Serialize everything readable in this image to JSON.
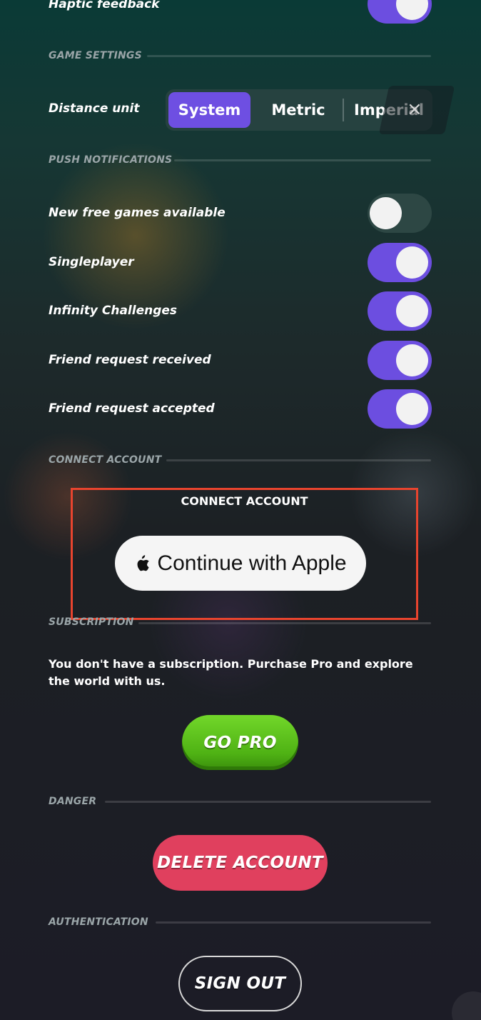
{
  "general": {
    "haptic_label": "Haptic feedback",
    "haptic_on": true
  },
  "game_settings": {
    "title": "GAME SETTINGS",
    "distance_label": "Distance unit",
    "options": [
      "System",
      "Metric",
      "Imperial"
    ],
    "selected": "System",
    "close_icon": "×"
  },
  "push_notifications": {
    "title": "PUSH NOTIFICATIONS",
    "items": [
      {
        "label": "New free games available",
        "on": false
      },
      {
        "label": "Singleplayer",
        "on": true
      },
      {
        "label": "Infinity Challenges",
        "on": true
      },
      {
        "label": "Friend request received",
        "on": true
      },
      {
        "label": "Friend request accepted",
        "on": true
      }
    ]
  },
  "connect_account": {
    "title": "CONNECT ACCOUNT",
    "caption": "CONNECT ACCOUNT",
    "apple_button_label": "Continue with Apple",
    "apple_icon": "apple-icon"
  },
  "subscription": {
    "title": "SUBSCRIPTION",
    "text": "You don't have a subscription. Purchase Pro and explore the world with us.",
    "button_label": "GO PRO"
  },
  "danger": {
    "title": "DANGER",
    "button_label": "DELETE ACCOUNT"
  },
  "authentication": {
    "title": "AUTHENTICATION",
    "button_label": "SIGN OUT"
  },
  "colors": {
    "accent": "#6c4ee0",
    "go_pro": "#4fb214",
    "delete": "#e0405e",
    "highlight": "#e8442e"
  }
}
